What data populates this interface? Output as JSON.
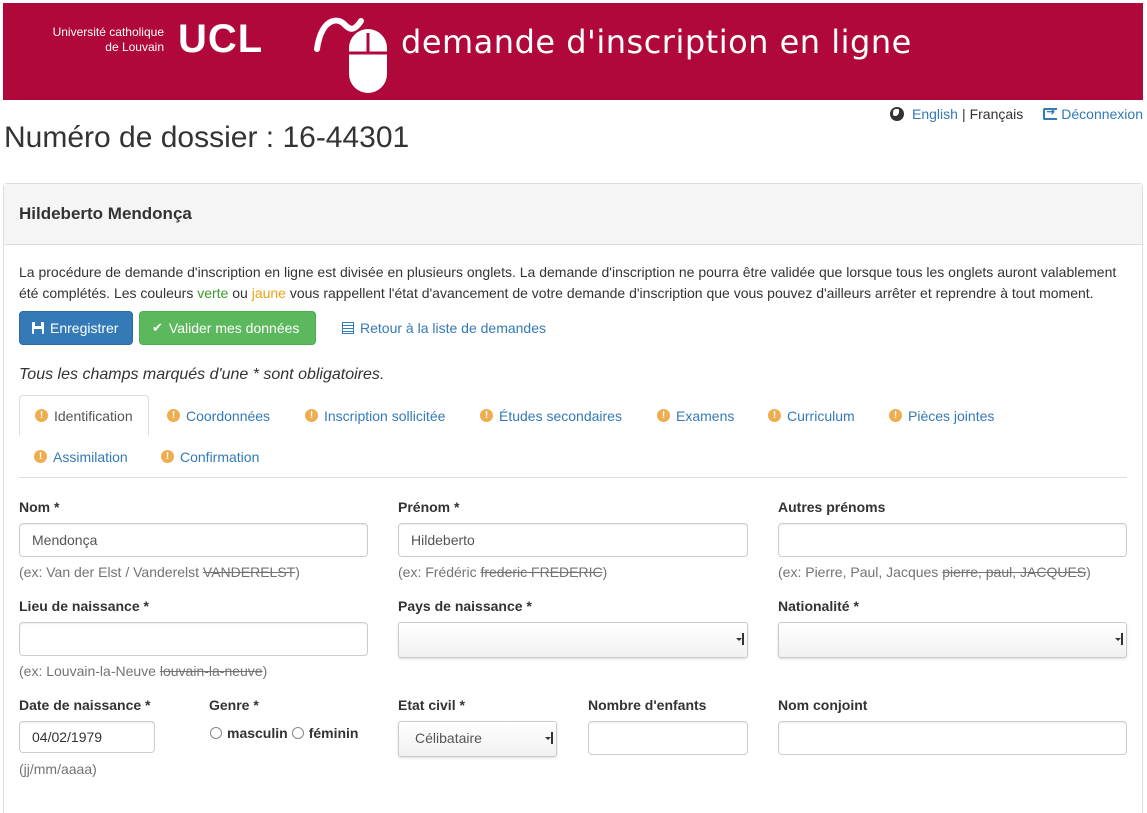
{
  "banner": {
    "university_line1": "Université catholique",
    "university_line2": "de Louvain",
    "logo_text": "UCL",
    "title": "demande d'inscription en ligne",
    "color": "#b0083b"
  },
  "top_links": {
    "english": "English",
    "separator": "|",
    "francais": "Français",
    "logout": "Déconnexion"
  },
  "page_title": "Numéro de dossier : 16-44301",
  "panel": {
    "heading": "Hildeberto Mendonça",
    "intro_part1": "La procédure de demande d'inscription en ligne est divisée en plusieurs onglets. La demande d'inscription ne pourra être validée que lorsque tous les onglets auront valablement été complétés. Les couleurs ",
    "intro_green": "verte",
    "intro_mid": " ou ",
    "intro_yellow": "jaune",
    "intro_part2": " vous rappellent l'état d'avancement de votre demande d'inscription que vous pouvez d'ailleurs arrêter et reprendre à tout moment.",
    "save_button": "Enregistrer",
    "validate_button": "Valider mes données",
    "back_link": "Retour à la liste de demandes",
    "required_note": "Tous les champs marqués d'une * sont obligatoires."
  },
  "tabs": [
    {
      "label": "Identification"
    },
    {
      "label": "Coordonnées"
    },
    {
      "label": "Inscription sollicitée"
    },
    {
      "label": "Études secondaires"
    },
    {
      "label": "Examens"
    },
    {
      "label": "Curriculum"
    },
    {
      "label": "Pièces jointes"
    },
    {
      "label": "Assimilation"
    },
    {
      "label": "Confirmation"
    }
  ],
  "form": {
    "nom": {
      "label": "Nom *",
      "value": "Mendonça",
      "help": "(ex: Van der Elst / Vanderelst ",
      "help_strike": "VANDERELST",
      "help_end": ")"
    },
    "prenom": {
      "label": "Prénom *",
      "value": "Hildeberto",
      "help": "(ex: Frédéric ",
      "help_strike": "frederic FREDERIC",
      "help_end": ")"
    },
    "autres_prenoms": {
      "label": "Autres prénoms",
      "value": "",
      "help": "(ex: Pierre, Paul, Jacques ",
      "help_strike": "pierre, paul, JACQUES",
      "help_end": ")"
    },
    "lieu_naissance": {
      "label": "Lieu de naissance *",
      "value": "",
      "help": "(ex: Louvain-la-Neuve ",
      "help_strike": "louvain-la-neuve",
      "help_end": ")"
    },
    "pays_naissance": {
      "label": "Pays de naissance *",
      "value": ""
    },
    "nationalite": {
      "label": "Nationalité *",
      "value": ""
    },
    "date_naissance": {
      "label": "Date de naissance *",
      "value": "04/02/1979",
      "help": "(jj/mm/aaaa)"
    },
    "genre": {
      "label": "Genre *",
      "option1": "masculin",
      "option2": "féminin"
    },
    "etat_civil": {
      "label": "Etat civil *",
      "value": "Célibataire"
    },
    "nombre_enfants": {
      "label": "Nombre d'enfants",
      "value": ""
    },
    "nom_conjoint": {
      "label": "Nom conjoint",
      "value": ""
    }
  }
}
